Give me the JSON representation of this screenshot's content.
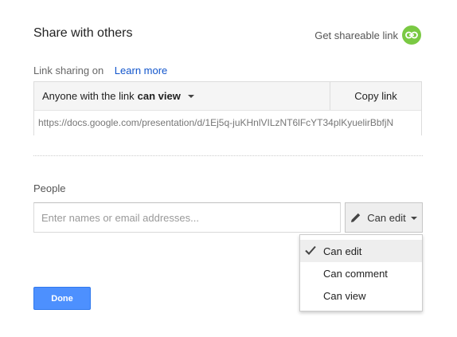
{
  "dialog": {
    "title": "Share with others",
    "get_link": {
      "label": "Get shareable link",
      "icon": "link-icon",
      "icon_color": "#7ac943"
    }
  },
  "link_sharing": {
    "status_label": "Link sharing on",
    "learn_more": "Learn more",
    "access_prefix": "Anyone with the link",
    "access_level": "can view",
    "copy_link": "Copy link",
    "url": "https://docs.google.com/presentation/d/1Ej5q-juKHnlVILzNT6lFcYT34plKyuelirBbfjN"
  },
  "people": {
    "label": "People",
    "input_value": "",
    "input_placeholder": "Enter names or email addresses...",
    "permission": {
      "icon": "pencil-icon",
      "label": "Can edit"
    }
  },
  "permission_menu": {
    "items": [
      {
        "label": "Can edit",
        "selected": true
      },
      {
        "label": "Can comment",
        "selected": false
      },
      {
        "label": "Can view",
        "selected": false
      }
    ]
  },
  "actions": {
    "done": "Done",
    "done_color": "#4d90fe"
  },
  "colors": {
    "link": "#1155cc",
    "accent_green": "#7ac943",
    "primary_blue": "#4d90fe"
  }
}
